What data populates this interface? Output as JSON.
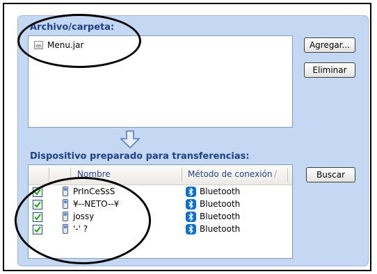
{
  "file_section": {
    "title": "Archivo/carpeta:",
    "files": [
      {
        "name": "Menu.jar",
        "icon": "jar-file-icon"
      }
    ]
  },
  "buttons": {
    "add": "Agregar...",
    "remove": "Eliminar",
    "search": "Buscar"
  },
  "device_section": {
    "title": "Dispositivo preparado para transferencias:",
    "columns": {
      "name": "Nombre",
      "method": "Método de conexión",
      "sort_glyph": "/"
    },
    "devices": [
      {
        "name": "PrInCeSsS",
        "method": "Bluetooth",
        "checked": true
      },
      {
        "name": "¥--NETO--¥",
        "method": "Bluetooth",
        "checked": true
      },
      {
        "name": "jossy",
        "method": "Bluetooth",
        "checked": true
      },
      {
        "name": "'-' ?",
        "method": "Bluetooth",
        "checked": true
      }
    ]
  },
  "colors": {
    "panel_bg": "#c4d8f3",
    "title_text": "#1f3f86",
    "bluetooth": "#0a6fd0",
    "checkbox_check": "#22a31c"
  }
}
